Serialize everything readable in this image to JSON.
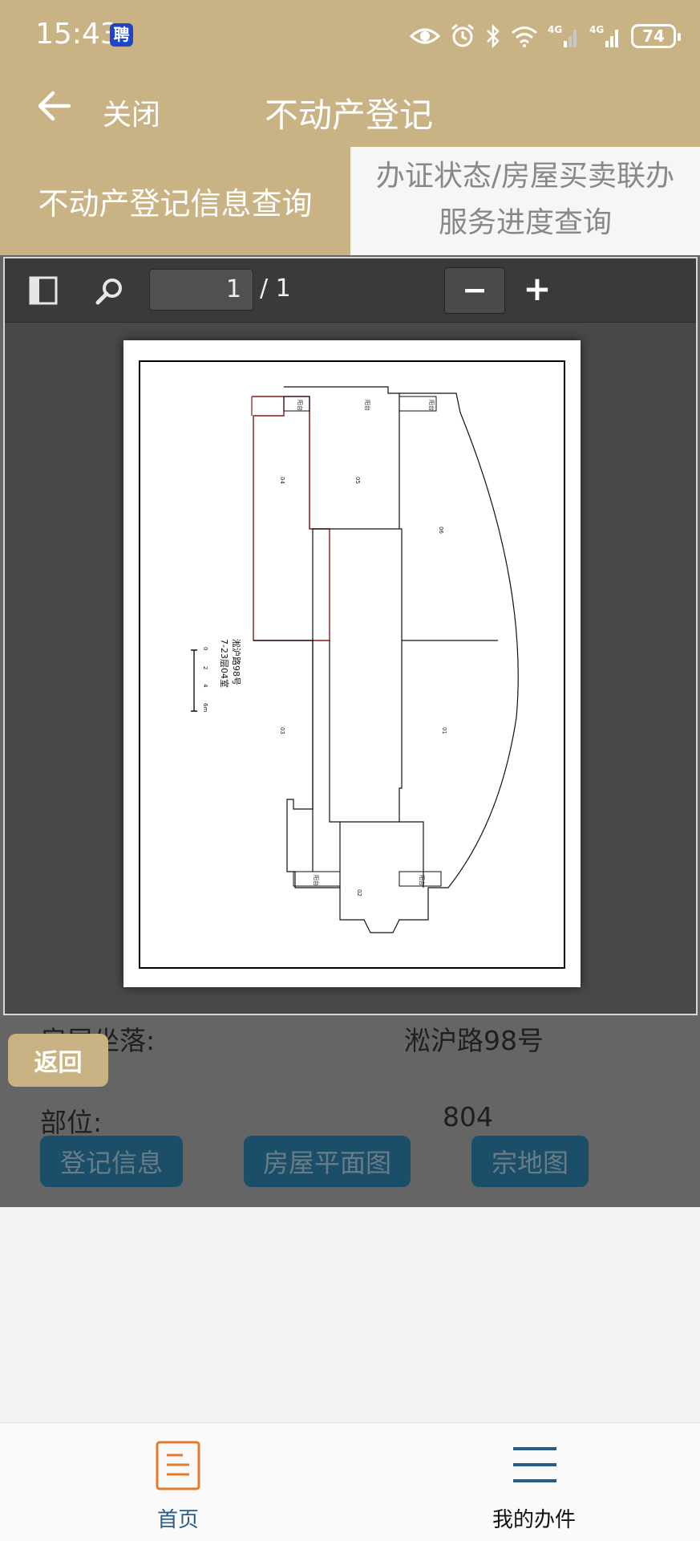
{
  "status_bar": {
    "time": "15:43",
    "app_badge": "聘",
    "battery": "74",
    "icons": [
      "eye-icon",
      "alarm-icon",
      "bluetooth-icon",
      "wifi-icon",
      "signal-4g-icon",
      "signal-4g-icon"
    ]
  },
  "header": {
    "close_label": "关闭",
    "title": "不动产登记"
  },
  "tabs": [
    {
      "label": "不动产登记信息查询",
      "active": true
    },
    {
      "label_line1": "办证状态/房屋买卖联办",
      "label_line2": "服务进度查询",
      "active": false
    }
  ],
  "pdf_viewer": {
    "page_number": "1",
    "page_total": "/ 1",
    "zoom_out_label": "−",
    "zoom_in_label": "+",
    "floor_plan": {
      "address": "淞沪路98号",
      "unit": "7-23层04室",
      "scale_ticks": [
        "0",
        "2",
        "4",
        "6m"
      ],
      "rooms": [
        "04",
        "05",
        "06",
        "03",
        "01",
        "02"
      ],
      "balcony_label": "阳台"
    }
  },
  "details": {
    "location_label": "房屋坐落:",
    "location_value": "淞沪路98号",
    "part_label": "部位:",
    "part_value": "804"
  },
  "actions": {
    "return_label": "返回",
    "registration_info": "登记信息",
    "floor_plan": "房屋平面图",
    "parcel_map": "宗地图"
  },
  "bottom_nav": {
    "home_label": "首页",
    "my_tasks_label": "我的办件"
  },
  "colors": {
    "brand": "#c9b384",
    "overlay": "#656565",
    "nav_active": "#e07a2c",
    "nav_blue": "#2a5d86"
  }
}
